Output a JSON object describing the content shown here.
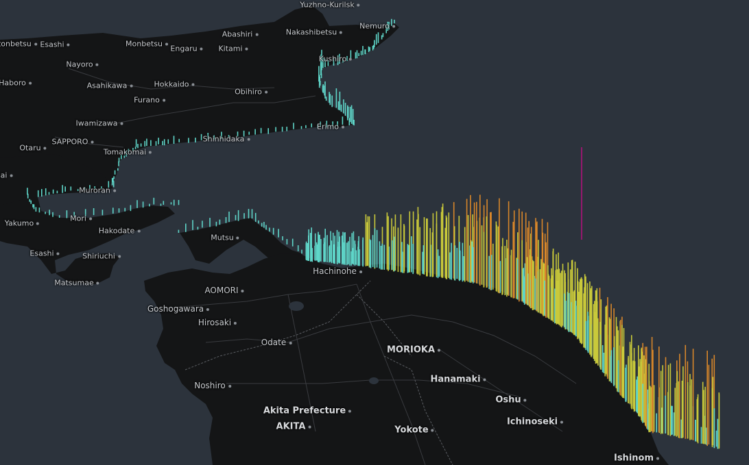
{
  "colors": {
    "water": "#2c333c",
    "land": "#141516",
    "border": "#4a4d51",
    "road": "#2a2c2f",
    "bar_low": "#5fd6c9",
    "bar_mid": "#c9c93a",
    "bar_high": "#d9872a",
    "bar_peak": "#b0127a"
  },
  "labels": [
    {
      "id": "yuzhno-kurilsk",
      "text": "Yuzhno-Kurilsk",
      "size": "s"
    },
    {
      "id": "nemuro",
      "text": "Nemuro",
      "size": "s"
    },
    {
      "id": "abashiri",
      "text": "Abashiri",
      "size": "s"
    },
    {
      "id": "nakashibetsu",
      "text": "Nakashibetsu",
      "size": "s"
    },
    {
      "id": "wakkanai",
      "text": "atonbetsu",
      "size": "s"
    },
    {
      "id": "esashi-n",
      "text": "Esashi",
      "size": "s"
    },
    {
      "id": "monbetsu",
      "text": "Monbetsu",
      "size": "s"
    },
    {
      "id": "engaru",
      "text": "Engaru",
      "size": "s"
    },
    {
      "id": "kitami",
      "text": "Kitami",
      "size": "s"
    },
    {
      "id": "kushiro",
      "text": "Kushiro",
      "size": "s"
    },
    {
      "id": "nayoro",
      "text": "Nayoro",
      "size": "s"
    },
    {
      "id": "haboro",
      "text": "Haboro",
      "size": "s"
    },
    {
      "id": "asahikawa",
      "text": "Asahikawa",
      "size": "s"
    },
    {
      "id": "hokkaido",
      "text": "Hokkaido",
      "size": "s"
    },
    {
      "id": "obihiro",
      "text": "Obihiro",
      "size": "s"
    },
    {
      "id": "furano",
      "text": "Furano",
      "size": "s"
    },
    {
      "id": "iwamizawa",
      "text": "Iwamizawa",
      "size": "s"
    },
    {
      "id": "erimo",
      "text": "Erimo",
      "size": "s"
    },
    {
      "id": "otaru",
      "text": "Otaru",
      "size": "s"
    },
    {
      "id": "sapporo",
      "text": "SAPPORO",
      "size": "s"
    },
    {
      "id": "tomakomai",
      "text": "Tomakomai",
      "size": "s"
    },
    {
      "id": "shinhidaka",
      "text": "Shinhidaka",
      "size": "s"
    },
    {
      "id": "nai",
      "text": "nai",
      "size": "s"
    },
    {
      "id": "muroran",
      "text": "Muroran",
      "size": "s"
    },
    {
      "id": "mori",
      "text": "Mori",
      "size": "s"
    },
    {
      "id": "yakumo",
      "text": "Yakumo",
      "size": "s"
    },
    {
      "id": "hakodate",
      "text": "Hakodate",
      "size": "s"
    },
    {
      "id": "esashi-s",
      "text": "Esashi",
      "size": "s"
    },
    {
      "id": "shiriuchi",
      "text": "Shiriuchi",
      "size": "s"
    },
    {
      "id": "matsumae",
      "text": "Matsumae",
      "size": "s"
    },
    {
      "id": "mutsu",
      "text": "Mutsu",
      "size": "s"
    },
    {
      "id": "hachinohe",
      "text": "Hachinohe",
      "size": "m"
    },
    {
      "id": "aomori",
      "text": "AOMORI",
      "size": "m"
    },
    {
      "id": "goshogawara",
      "text": "Goshogawara",
      "size": "m"
    },
    {
      "id": "hirosaki",
      "text": "Hirosaki",
      "size": "m"
    },
    {
      "id": "odate",
      "text": "Odate",
      "size": "m"
    },
    {
      "id": "morioka",
      "text": "MORIOKA",
      "size": "l"
    },
    {
      "id": "hanamaki",
      "text": "Hanamaki",
      "size": "l"
    },
    {
      "id": "noshiro",
      "text": "Noshiro",
      "size": "m"
    },
    {
      "id": "oshu",
      "text": "Oshu",
      "size": "l"
    },
    {
      "id": "ichinoseki",
      "text": "Ichinoseki",
      "size": "l"
    },
    {
      "id": "akita-pref",
      "text": "Akita Prefecture",
      "size": "l"
    },
    {
      "id": "akita",
      "text": "AKITA",
      "size": "l"
    },
    {
      "id": "yokote",
      "text": "Yokote",
      "size": "l"
    },
    {
      "id": "ishinomaki",
      "text": "Ishinom",
      "size": "l"
    }
  ]
}
